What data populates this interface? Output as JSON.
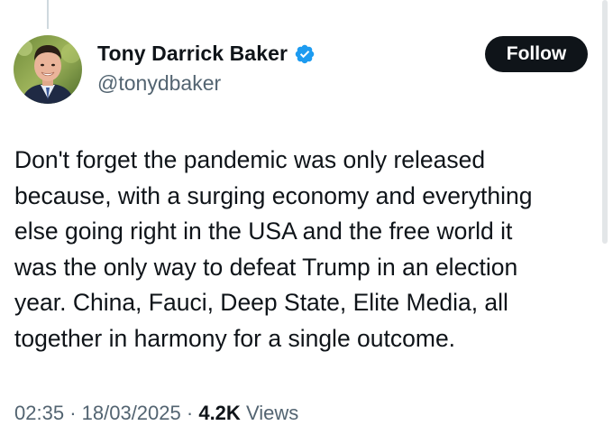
{
  "author": {
    "name": "Tony Darrick Baker",
    "handle": "@tonydbaker",
    "verified": true,
    "verified_icon": "verified-badge-icon",
    "verified_color": "#1d9bf0"
  },
  "follow_button": {
    "label": "Follow"
  },
  "tweet": {
    "text": "Don't forget the pandemic was only released\nbecause, with a surging economy and everything\nelse going right in the USA and the free world it\nwas the only way to defeat Trump in an election\nyear. China, Fauci, Deep State, Elite Media, all\ntogether in harmony for a single outcome."
  },
  "meta": {
    "time": "02:35",
    "separator": "·",
    "date": "18/03/2025",
    "views_count": "4.2K",
    "views_label": "Views"
  },
  "colors": {
    "text_primary": "#0f1419",
    "text_secondary": "#536471",
    "follow_bg": "#0f1419"
  }
}
